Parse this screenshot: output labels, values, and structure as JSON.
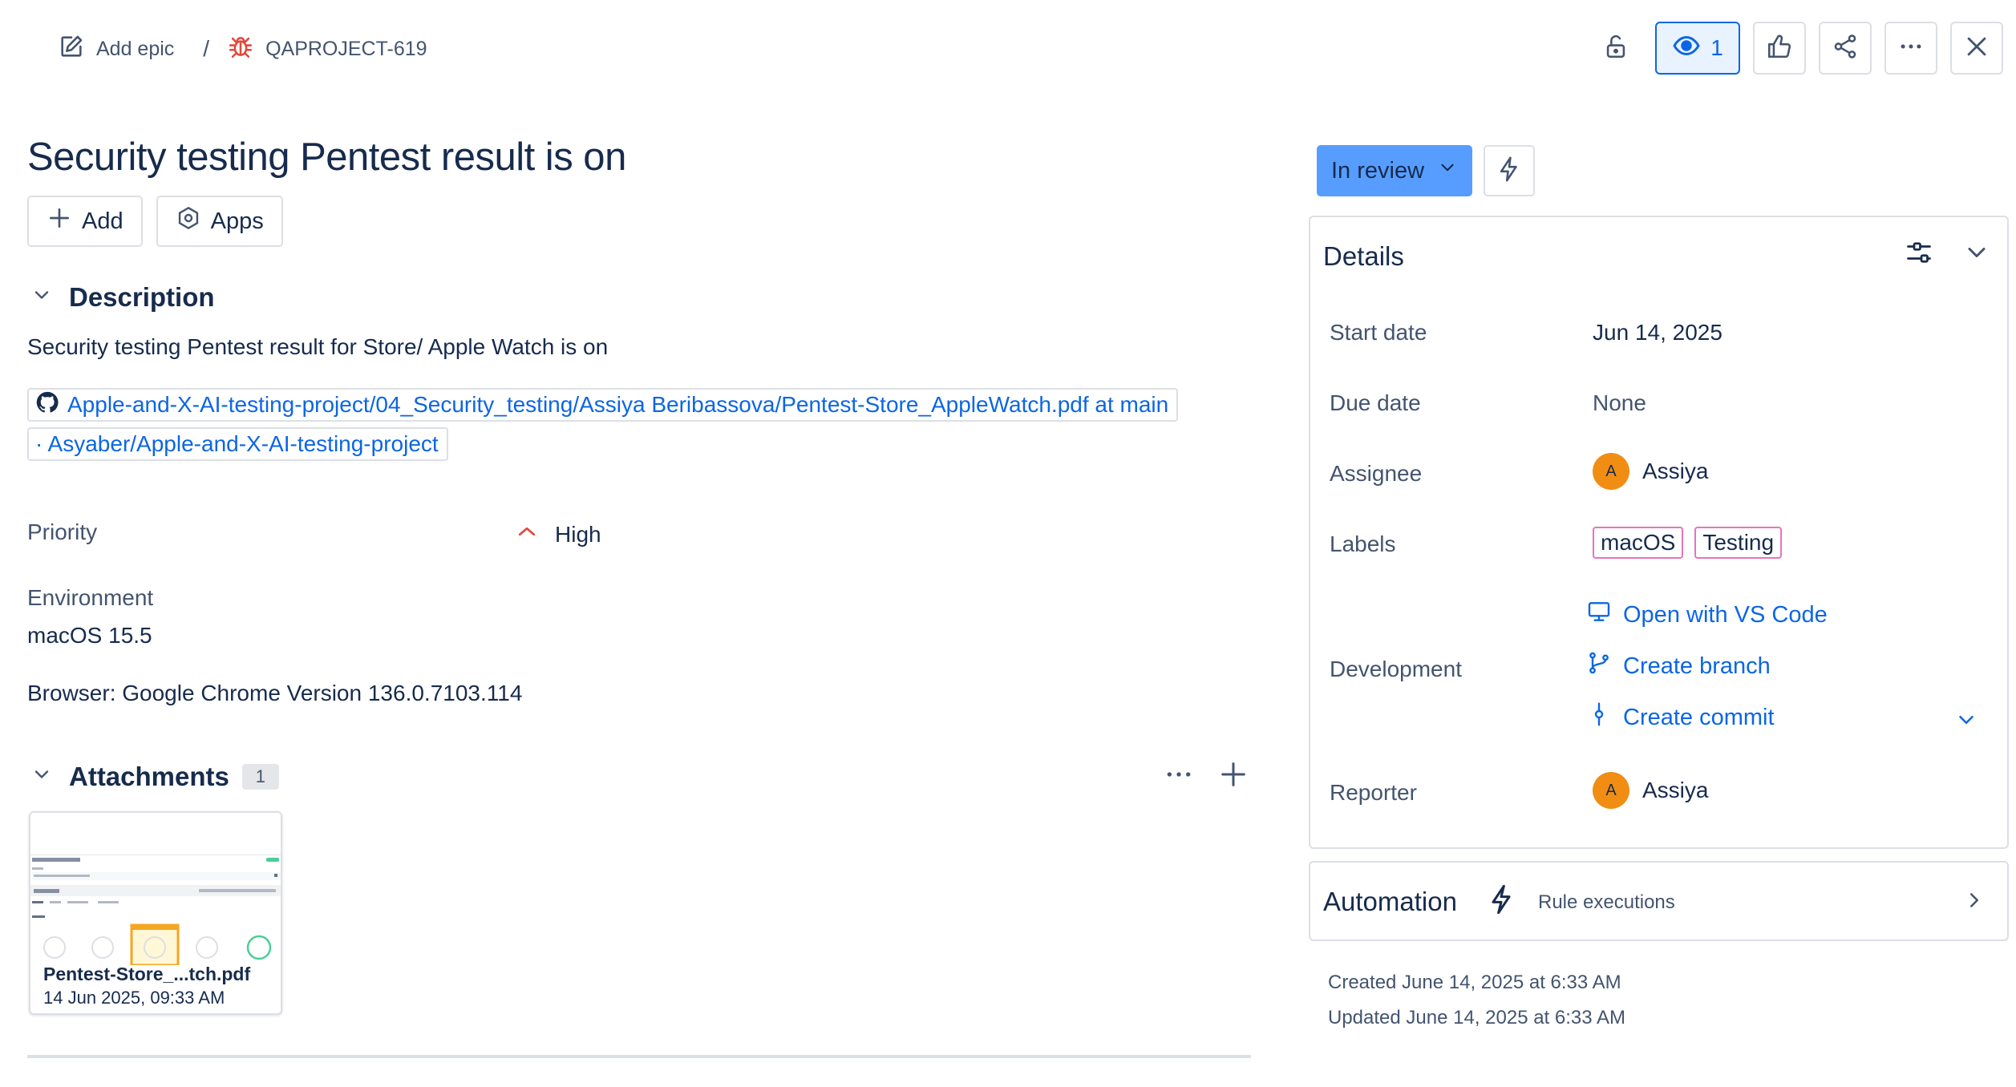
{
  "breadcrumb": {
    "epic_label": "Add epic",
    "separator": "/",
    "issue_key": "QAPROJECT-619"
  },
  "top_actions": {
    "watch_count": "1",
    "icons": [
      "unlock-icon",
      "eye-icon",
      "thumbs-up-icon",
      "share-icon",
      "more-icon",
      "close-icon"
    ]
  },
  "issue": {
    "title": "Security testing Pentest result is on",
    "add_label": "Add",
    "apps_label": "Apps"
  },
  "description": {
    "heading": "Description",
    "text": "Security testing Pentest result for Store/ Apple Watch is on",
    "link_line_1": "Apple-and-X-AI-testing-project/04_Security_testing/Assiya Beribassova/Pentest-Store_AppleWatch.pdf at main",
    "link_line_2": "· Asyaber/Apple-and-X-AI-testing-project"
  },
  "fields": {
    "priority_label": "Priority",
    "priority_value": "High",
    "environment_label": "Environment",
    "environment_os": "macOS 15.5",
    "environment_browser": "Browser: Google Chrome Version 136.0.7103.114"
  },
  "attachments": {
    "heading": "Attachments",
    "count": "1",
    "items": [
      {
        "name": "Pentest-Store_...tch.pdf",
        "date": "14 Jun 2025, 09:33 AM"
      }
    ]
  },
  "status": {
    "label": "In review",
    "color": "#579dff"
  },
  "details": {
    "title": "Details",
    "start_date_label": "Start date",
    "start_date_value": "Jun 14, 2025",
    "due_date_label": "Due date",
    "due_date_value": "None",
    "assignee_label": "Assignee",
    "assignee_initial": "A",
    "assignee_name": "Assiya",
    "labels_label": "Labels",
    "labels": [
      "macOS",
      "Testing"
    ],
    "development_label": "Development",
    "dev_open_vscode": "Open with VS Code",
    "dev_create_branch": "Create branch",
    "dev_create_commit": "Create commit",
    "reporter_label": "Reporter",
    "reporter_initial": "A",
    "reporter_name": "Assiya"
  },
  "automation": {
    "title": "Automation",
    "subtitle": "Rule executions"
  },
  "meta": {
    "created": "Created June 14, 2025 at 6:33 AM",
    "updated": "Updated June 14, 2025 at 6:33 AM"
  },
  "colors": {
    "link": "#0c66e4",
    "avatar": "#f18d13",
    "label_border": "#e774bb",
    "priority_high": "#e2483d",
    "bug": "#e2483d"
  }
}
